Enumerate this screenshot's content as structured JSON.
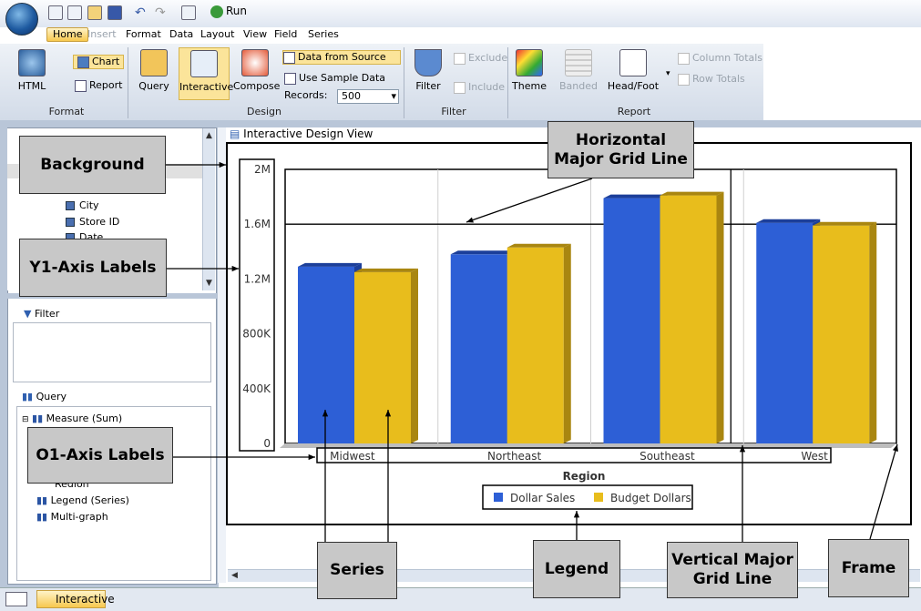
{
  "toolbar": {
    "run_label": "Run"
  },
  "menu": [
    "Home",
    "Insert",
    "Format",
    "Data",
    "Layout",
    "View",
    "Field",
    "Series"
  ],
  "ribbon": {
    "format": {
      "html": "HTML",
      "chart": "Chart",
      "report": "Report",
      "group": "Format"
    },
    "design": {
      "query": "Query",
      "interactive": "Interactive",
      "compose": "Compose",
      "data_from_source": "Data from Source",
      "use_sample": "Use Sample Data",
      "records_label": "Records:",
      "records_value": "500",
      "group": "Design"
    },
    "filter": {
      "filter": "Filter",
      "exclude": "Exclude",
      "include": "Include",
      "group": "Filter"
    },
    "report": {
      "theme": "Theme",
      "banded": "Banded",
      "headfoot": "Head/Foot",
      "column_totals": "Column Totals",
      "row_totals": "Row Totals",
      "group": "Report"
    }
  },
  "tree": {
    "items": [
      "City",
      "Store ID",
      "Date"
    ]
  },
  "filter_panel": {
    "title": "Filter"
  },
  "query_panel": {
    "title": "Query",
    "items": [
      "Measure (Sum)",
      "Region",
      "Legend (Series)",
      "Multi-graph"
    ]
  },
  "design_view": {
    "caption": "Interactive Design View"
  },
  "chart_data": {
    "type": "bar",
    "categories": [
      "Midwest",
      "Northeast",
      "Southeast",
      "West"
    ],
    "series": [
      {
        "name": "Dollar Sales",
        "values": [
          1290000,
          1380000,
          1790000,
          1610000
        ],
        "color": "#2d5fd6"
      },
      {
        "name": "Budget Dollars",
        "values": [
          1250000,
          1430000,
          1810000,
          1590000
        ],
        "color": "#e8bd1c"
      }
    ],
    "yticks": [
      "0",
      "400K",
      "800K",
      "1.2M",
      "1.6M",
      "2M"
    ],
    "ylim": [
      0,
      2000000
    ],
    "xlabel": "Region",
    "ylabel": "",
    "legend_position": "bottom"
  },
  "annotations": {
    "background": "Background",
    "y1_axis": "Y1-Axis Labels",
    "o1_axis": "O1-Axis Labels",
    "hgrid": "Horizontal Major Grid Line",
    "series": "Series",
    "legend": "Legend",
    "vgrid": "Vertical Major Grid Line",
    "frame": "Frame"
  },
  "status": {
    "tab": "Interactive"
  }
}
